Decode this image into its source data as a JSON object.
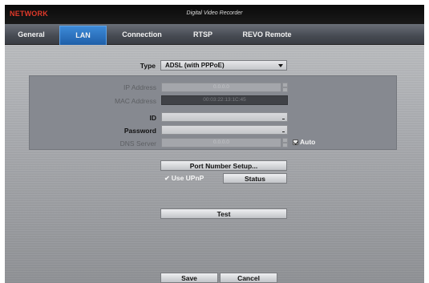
{
  "title_bar": {
    "section": "NETWORK",
    "app_name": "Digital Video Recorder"
  },
  "tabs": [
    {
      "label": "General",
      "active": false
    },
    {
      "label": "LAN",
      "active": true
    },
    {
      "label": "Connection",
      "active": false
    },
    {
      "label": "RTSP",
      "active": false
    },
    {
      "label": "REVO Remote",
      "active": false
    }
  ],
  "lan": {
    "type_label": "Type",
    "type_value": "ADSL (with PPPoE)",
    "ip_label": "IP Address",
    "ip_value": "0.0.0.0",
    "mac_label": "MAC Address",
    "mac_value": "00:03:22:13:1C:45",
    "id_label": "ID",
    "id_value": "",
    "password_label": "Password",
    "password_value": "",
    "dns_label": "DNS Server",
    "dns_value": "0.0.0.0",
    "auto_label": "Auto",
    "auto_checked": true
  },
  "actions": {
    "port_setup_label": "Port Number Setup...",
    "use_upnp_label": "Use UPnP",
    "use_upnp_checked": true,
    "status_label": "Status",
    "test_label": "Test",
    "save_label": "Save",
    "cancel_label": "Cancel"
  },
  "colors": {
    "title_accent": "#e0392a",
    "tab_active": "#2b6fc0"
  },
  "icons": {
    "dropdown": "chevron-down-icon",
    "checkbox": "checkbox-checked-icon",
    "upnp": "checkmark-icon"
  }
}
